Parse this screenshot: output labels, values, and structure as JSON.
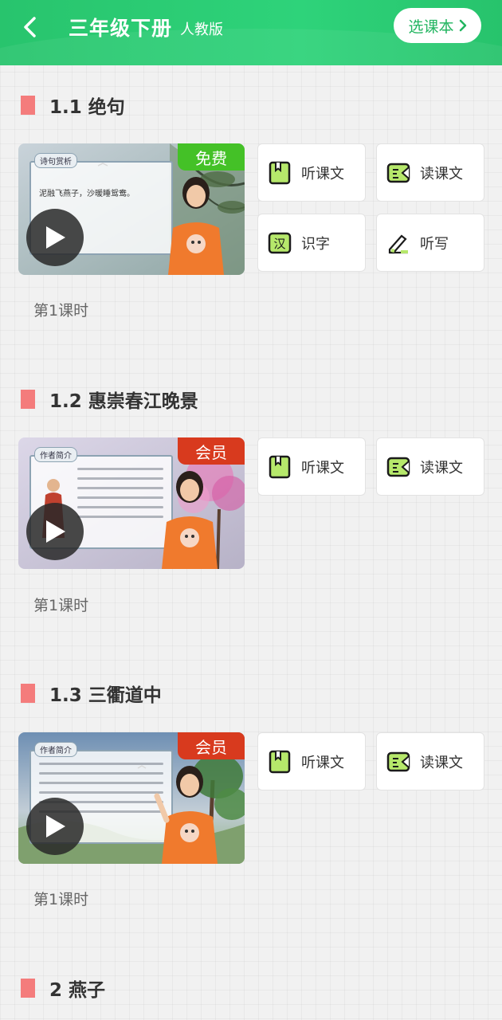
{
  "header": {
    "title": "三年级下册",
    "edition": "人教版",
    "select_button": "选课本"
  },
  "sections": [
    {
      "title": "1.1 绝句",
      "badge": "免费",
      "lesson_time": "第1课时",
      "board_tag": "诗句赏析",
      "board_text": "泥融飞燕子，沙暖睡鸳鸯。",
      "tiles": [
        "听课文",
        "读课文",
        "识字",
        "听写"
      ]
    },
    {
      "title": "1.2 惠崇春江晚景",
      "badge": "会员",
      "lesson_time": "第1课时",
      "board_tag": "作者简介",
      "tiles": [
        "听课文",
        "读课文"
      ]
    },
    {
      "title": "1.3 三衢道中",
      "badge": "会员",
      "lesson_time": "第1课时",
      "board_tag": "作者简介",
      "tiles": [
        "听课文",
        "读课文"
      ]
    },
    {
      "title": "2 燕子"
    }
  ],
  "colors": {
    "header_green": "#2ed37a",
    "free_badge": "#44c127",
    "vip_badge": "#d83a1e",
    "section_marker": "#f47c7c",
    "icon_green": "#b6e86b"
  }
}
